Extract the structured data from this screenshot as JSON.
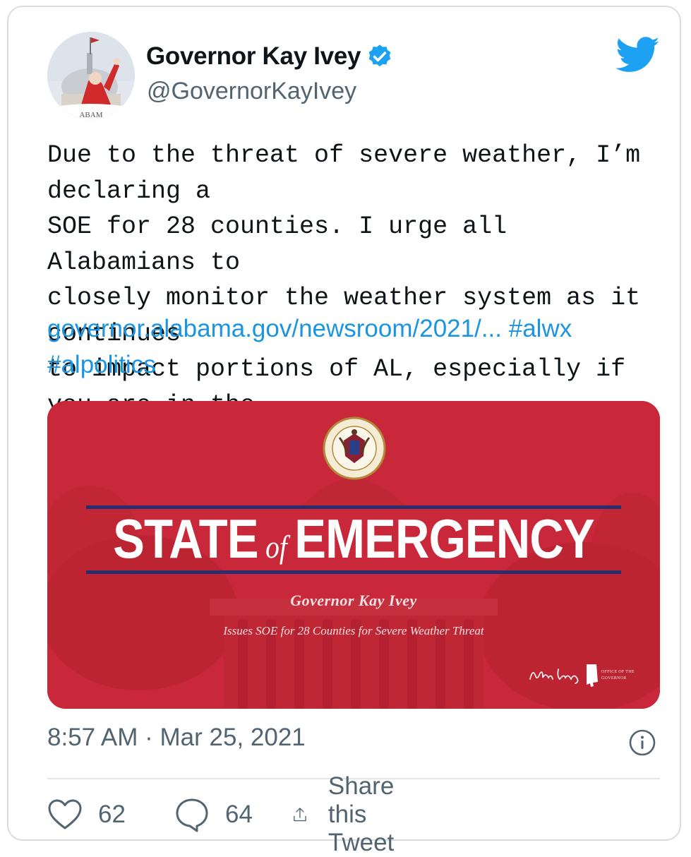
{
  "author": {
    "display_name": "Governor Kay Ivey",
    "handle": "@GovernorKayIvey",
    "verified": true,
    "avatar_banner_text": "ABAM"
  },
  "tweet": {
    "text": "Due to the threat of severe weather, I’m declaring a\nSOE for 28 counties. I urge all Alabamians to\nclosely monitor the weather system as it continues\nto impact portions of AL, especially if you are in the\nline of the highest risk storms.",
    "link": "governor.alabama.gov/newsroom/2021/...",
    "hashtags": [
      "#alwx",
      "#alpolitics"
    ],
    "timestamp": "8:57 AM · Mar 25, 2021"
  },
  "media": {
    "title_part1": "STATE",
    "title_of": "of",
    "title_part2": "EMERGENCY",
    "subtitle": "Governor Kay Ivey",
    "caption": "Issues SOE for 28 Counties for Severe Weather Threat",
    "signature": "Kay Ivey",
    "office": "Office of the Governor",
    "seal_text": "Office of the Governor · State of Alabama",
    "colors": {
      "background": "#c8283a",
      "rule": "#2a2d6e"
    }
  },
  "actions": {
    "likes": "62",
    "replies": "64",
    "share_label": "Share this Tweet"
  },
  "colors": {
    "link": "#1b95e0",
    "secondary_text": "#536471",
    "twitter_blue": "#1da1f2"
  },
  "icons": {
    "verified": "verified-badge-icon",
    "brand": "twitter-bird-icon",
    "info": "info-icon",
    "like": "heart-icon",
    "reply": "reply-bubble-icon",
    "share": "share-upload-icon"
  }
}
